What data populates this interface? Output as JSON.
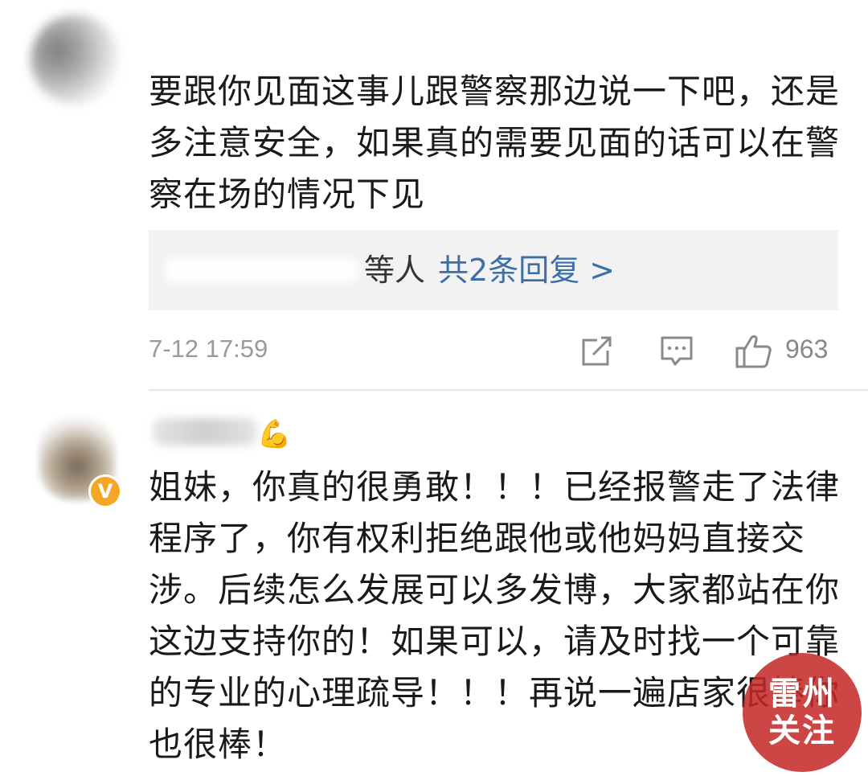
{
  "comments": [
    {
      "username": "",
      "text": "要跟你见面这事儿跟警察那边说一下吧，还是多注意安全，如果真的需要见面的话可以在警察在场的情况下见",
      "replies": {
        "others_label": "等人",
        "count_label": "共2条回复 >"
      },
      "timestamp": "7-12 17:59",
      "actions": {
        "share_icon": "share-icon",
        "comment_icon": "comment-icon",
        "like_icon": "thumbs-up-icon",
        "like_count": "963"
      }
    },
    {
      "username": "",
      "verified_badge": "V",
      "verified_color": "#f5a623",
      "name_emoji": "💪",
      "text": "姐妹，你真的很勇敢！！！已经报警走了法律程序了，你有权利拒绝跟他或他妈妈直接交涉。后续怎么发展可以多发博，大家都站在你这边支持你的！如果可以，请及时找一个可靠的专业的心理疏导！！！再说一遍店家很棒你也很棒！"
    }
  ],
  "watermark": {
    "line1": "雷州",
    "line2": "关注",
    "color": "#c42828"
  },
  "colors": {
    "link": "#3d6ea8",
    "meta": "#9a9a9a",
    "reply_bg": "#f2f2f2"
  }
}
